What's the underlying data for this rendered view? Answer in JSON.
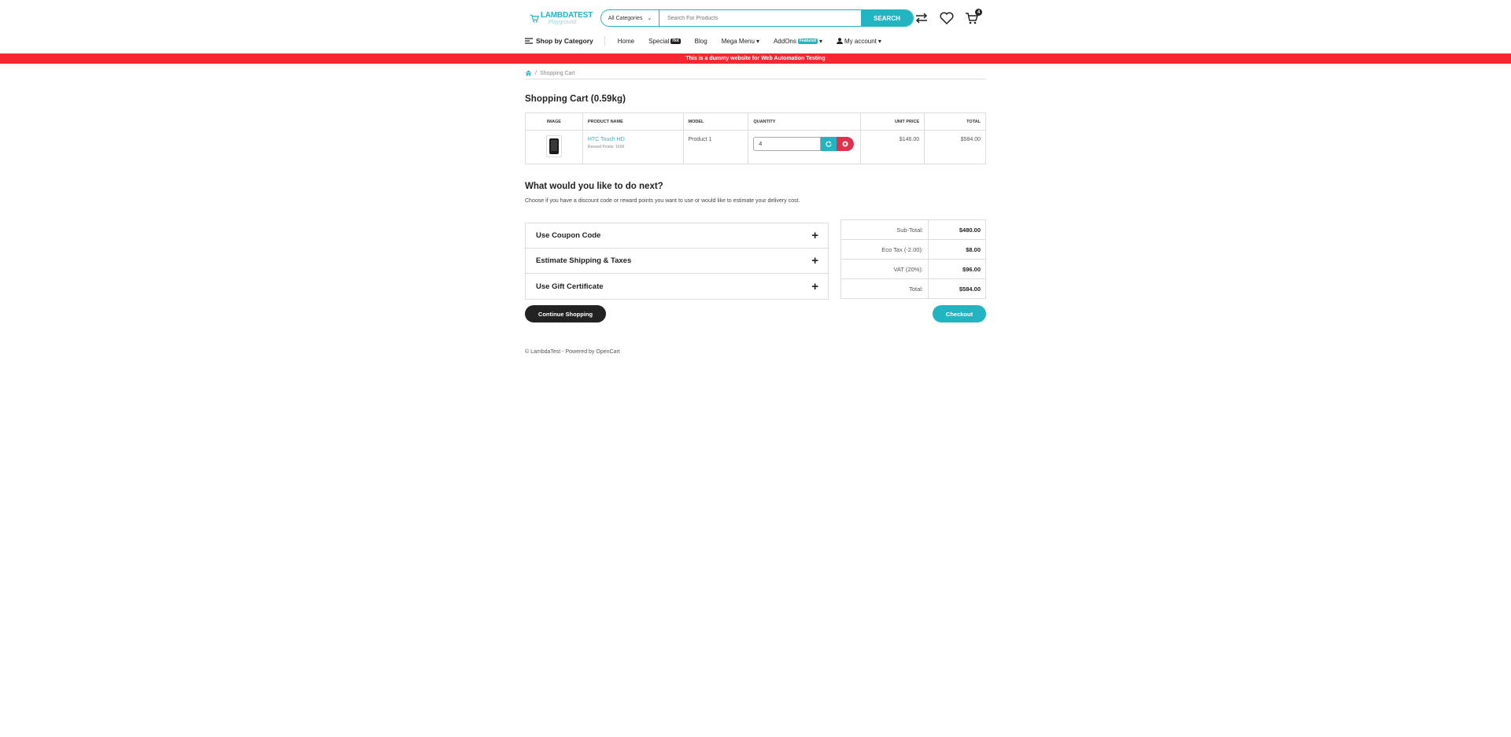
{
  "header": {
    "logo_top": "LAMBDATEST",
    "logo_bottom": "Playground",
    "search": {
      "category": "All Categories",
      "placeholder": "Search For Products",
      "button": "SEARCH"
    },
    "cart_count": "4"
  },
  "nav": {
    "shop_by_category": "Shop by Category",
    "items": [
      {
        "label": "Home"
      },
      {
        "label": "Special",
        "badge": "Hot"
      },
      {
        "label": "Blog"
      },
      {
        "label": "Mega Menu"
      },
      {
        "label": "AddOns",
        "badge": "Featured"
      },
      {
        "label": "My account"
      }
    ]
  },
  "banner": "This is a dummy website for Web Automation Testing",
  "breadcrumb": {
    "current": "Shopping Cart"
  },
  "page_title": "Shopping Cart  (0.59kg)",
  "cart_table": {
    "headers": [
      "Image",
      "Product Name",
      "Model",
      "Quantity",
      "Unit Price",
      "Total"
    ],
    "rows": [
      {
        "name": "HTC Touch HD",
        "reward": "Reward Points: 1600",
        "model": "Product 1",
        "quantity": "4",
        "unit_price": "$146.00",
        "total": "$584.00"
      }
    ]
  },
  "next": {
    "title": "What would you like to do next?",
    "description": "Choose if you have a discount code or reward points you want to use or would like to estimate your delivery cost."
  },
  "accordion": [
    "Use Coupon Code",
    "Estimate Shipping & Taxes",
    "Use Gift Certificate"
  ],
  "totals": [
    {
      "label": "Sub-Total:",
      "value": "$480.00"
    },
    {
      "label": "Eco Tax (-2.00):",
      "value": "$8.00"
    },
    {
      "label": "VAT (20%):",
      "value": "$96.00"
    },
    {
      "label": "Total:",
      "value": "$584.00"
    }
  ],
  "buttons": {
    "continue": "Continue Shopping",
    "checkout": "Checkout"
  },
  "footer": "© LambdaTest - Powered by OpenCart",
  "colors": {
    "accent": "#23b4c2",
    "banner": "#f5272f",
    "danger": "#e0314d",
    "dark": "#222222"
  }
}
